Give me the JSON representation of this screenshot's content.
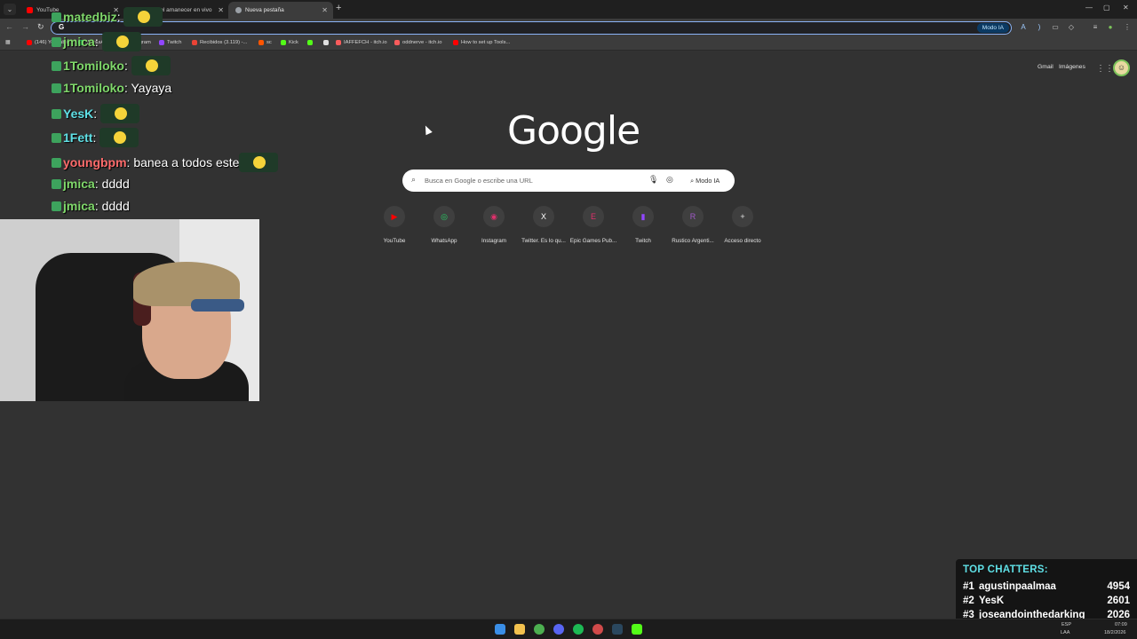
{
  "browser": {
    "tabs": [
      {
        "label": "YouTube",
        "active": false,
        "color": "#ff0000"
      },
      {
        "label": "antes del amanecer en vivo",
        "active": false,
        "color": "#e54b2c"
      },
      {
        "label": "Nueva pestaña",
        "active": true,
        "color": "#9aa0a6"
      }
    ],
    "omnibox_text": "G",
    "omnibox_modo": "Modo IA"
  },
  "bookmarks": [
    {
      "label": "(146) YouTube",
      "color": "#ff0000"
    },
    {
      "label": "WhatsApp",
      "color": "#25d366"
    },
    {
      "label": "Instagram",
      "color": "#e1306c"
    },
    {
      "label": "Twitch",
      "color": "#9146ff"
    },
    {
      "label": "Recibidos (3.119) -...",
      "color": "#ea4335"
    },
    {
      "label": "sc",
      "color": "#ff5500"
    },
    {
      "label": "Kick",
      "color": "#53fc18"
    },
    {
      "label": "",
      "color": "#53fc18"
    },
    {
      "label": "",
      "color": "#e0e0e0"
    },
    {
      "label": "IAFFEFCH - itch.io",
      "color": "#fa5c5c"
    },
    {
      "label": "oddnerve - itch.io",
      "color": "#fa5c5c"
    },
    {
      "label": "How to set up Tools...",
      "color": "#ff0000"
    }
  ],
  "google": {
    "logo": "Google",
    "search_placeholder": "Busca en Google o escribe una URL",
    "modo_ia": "Modo IA",
    "top_links": [
      "Gmail",
      "Imágenes"
    ],
    "shortcuts": [
      {
        "label": "YouTube",
        "glyph": "▶",
        "color": "#ff0000"
      },
      {
        "label": "WhatsApp",
        "glyph": "◎",
        "color": "#25d366"
      },
      {
        "label": "Instagram",
        "glyph": "◉",
        "color": "#e1306c"
      },
      {
        "label": "Twitter. Es lo qu...",
        "glyph": "X",
        "color": "#ffffff"
      },
      {
        "label": "Epic Games Pub...",
        "glyph": "E",
        "color": "#e1306c"
      },
      {
        "label": "Twitch",
        "glyph": "▮",
        "color": "#9146ff"
      },
      {
        "label": "Rustico Argenti...",
        "glyph": "R",
        "color": "#a05ac8"
      },
      {
        "label": "Acceso directo",
        "glyph": "+",
        "color": "#e3e3e3"
      }
    ]
  },
  "chat": [
    {
      "user": "matedbiz",
      "message": "",
      "color": "#7fd86a"
    },
    {
      "user": "jmica",
      "message": "",
      "color": "#7fd86a"
    },
    {
      "user": "1Tomiloko",
      "message": "",
      "color": "#7fd86a"
    },
    {
      "user": "1Tomiloko",
      "message": "Yayaya",
      "color": "#7fd86a"
    },
    {
      "user": "YesK",
      "message": "",
      "color": "#5fe0e6"
    },
    {
      "user": "1Fett",
      "message": "",
      "color": "#5fe0e6"
    },
    {
      "user": "youngbpm",
      "message": "banea a todos este",
      "color": "#ff6b6b"
    },
    {
      "user": "jmica",
      "message": "dddd",
      "color": "#7fd86a"
    },
    {
      "user": "jmica",
      "message": "dddd",
      "color": "#7fd86a"
    }
  ],
  "top_chatters": {
    "title": "TOP CHATTERS:",
    "rows": [
      {
        "rank": "#1",
        "name": "agustinpaalmaa",
        "count": "4954"
      },
      {
        "rank": "#2",
        "name": "YesK",
        "count": "2601"
      },
      {
        "rank": "#3",
        "name": "joseandointhedarking",
        "count": "2026"
      }
    ]
  },
  "taskbar": {
    "lang_top": "ESP",
    "lang_bottom": "LAA",
    "time": "07:09",
    "date": "18/2/2026"
  }
}
